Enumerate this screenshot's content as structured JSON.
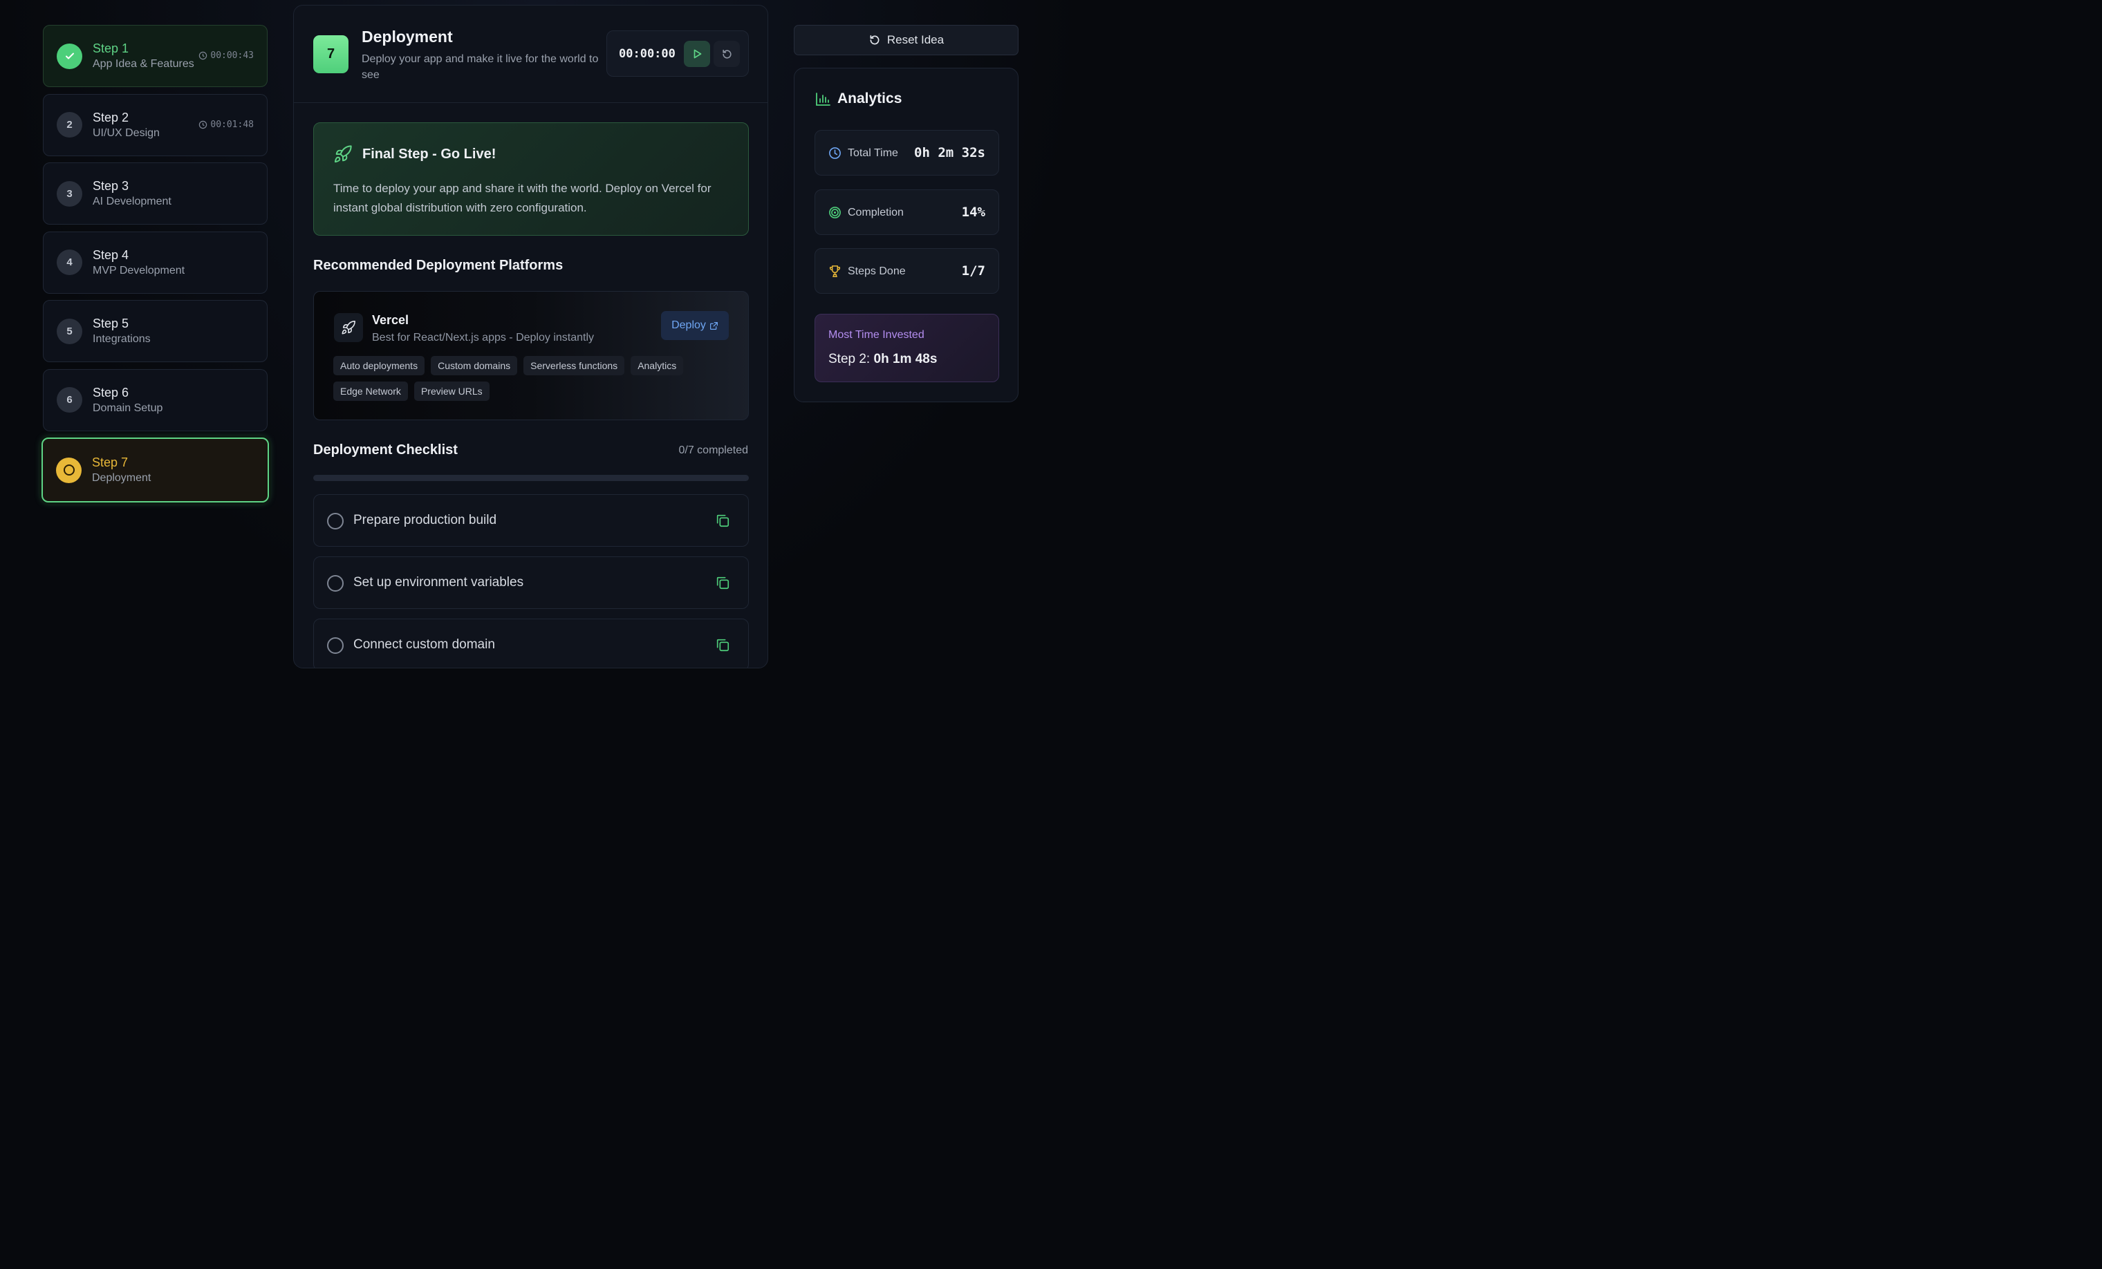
{
  "steps": [
    {
      "num": "1",
      "title": "Step 1",
      "subtitle": "App Idea & Features",
      "timer": "00:00:43",
      "state": "done"
    },
    {
      "num": "2",
      "title": "Step 2",
      "subtitle": "UI/UX Design",
      "timer": "00:01:48",
      "state": "idle"
    },
    {
      "num": "3",
      "title": "Step 3",
      "subtitle": "AI Development",
      "state": "idle"
    },
    {
      "num": "4",
      "title": "Step 4",
      "subtitle": "MVP Development",
      "state": "idle"
    },
    {
      "num": "5",
      "title": "Step 5",
      "subtitle": "Integrations",
      "state": "idle"
    },
    {
      "num": "6",
      "title": "Step 6",
      "subtitle": "Domain Setup",
      "state": "idle"
    },
    {
      "num": "7",
      "title": "Step 7",
      "subtitle": "Deployment",
      "state": "active"
    }
  ],
  "header": {
    "badge": "7",
    "title": "Deployment",
    "description": "Deploy your app and make it live for the world to see",
    "timer": "00:00:00"
  },
  "golive": {
    "title": "Final Step - Go Live!",
    "text": "Time to deploy your app and share it with the world. Deploy on Vercel for instant global distribution with zero configuration."
  },
  "platforms_section": {
    "title": "Recommended Deployment Platforms"
  },
  "platform": {
    "name": "Vercel",
    "description": "Best for React/Next.js apps - Deploy instantly",
    "deploy_label": "Deploy",
    "tags": [
      "Auto deployments",
      "Custom domains",
      "Serverless functions",
      "Analytics",
      "Edge Network",
      "Preview URLs"
    ]
  },
  "checklist": {
    "title": "Deployment Checklist",
    "count": "0/7 completed",
    "progress": 0,
    "items": [
      "Prepare production build",
      "Set up environment variables",
      "Connect custom domain"
    ]
  },
  "right": {
    "reset_label": "Reset Idea",
    "analytics_title": "Analytics",
    "stats": [
      {
        "label": "Total Time",
        "value": "0h 2m 32s",
        "icon": "clock-icon"
      },
      {
        "label": "Completion",
        "value": "14%",
        "icon": "target-icon"
      },
      {
        "label": "Steps Done",
        "value": "1/7",
        "icon": "trophy-icon"
      }
    ],
    "most_label": "Most Time Invested",
    "most_step": "Step 2:",
    "most_time": "0h 1m 48s"
  },
  "colors": {
    "accent": "#4fcf7b",
    "active": "#e8b838",
    "link": "#6fa6f3",
    "purple": "#b48ef0"
  }
}
